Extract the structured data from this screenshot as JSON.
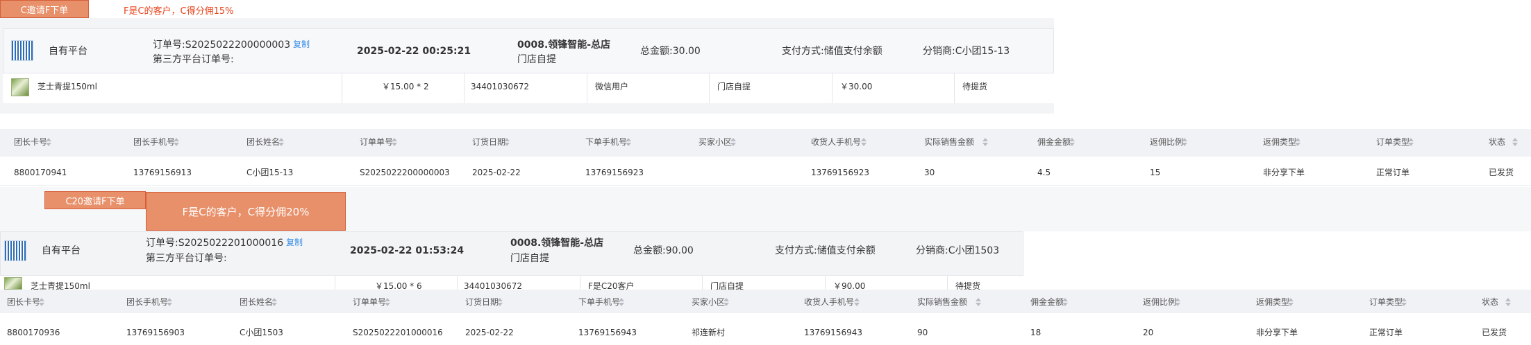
{
  "sections": [
    {
      "tag": "C邀请F下单",
      "note": "F是C的客户，C得分佣15%",
      "order": {
        "platform": "自有平台",
        "order_no": "订单号:S2025022200000003",
        "copy": "复制",
        "third_party": "第三方平台订单号:",
        "datetime": "2025-02-22 00:25:21",
        "store": "0008.领锋智能-总店",
        "pickup": "门店自提",
        "total": "总金额:30.00",
        "payment": "支付方式:储值支付余额",
        "distributor": "分销商:C小团15-13"
      },
      "item": {
        "name": "芝士青提150ml",
        "price_qty": "￥15.00 * 2",
        "phone": "34401030672",
        "buyer": "微信用户",
        "delivery": "门店自提",
        "amount": "￥30.00",
        "status": "待提货"
      },
      "table_row": [
        "8800170941",
        "13769156913",
        "C小团15-13",
        "S2025022200000003",
        "2025-02-22",
        "13769156923",
        "",
        "13769156923",
        "30",
        "4.5",
        "15",
        "非分享下单",
        "正常订单",
        "已发货"
      ]
    },
    {
      "tag": "C20邀请F下单",
      "note": "F是C的客户，C得分佣20%",
      "order": {
        "platform": "自有平台",
        "order_no": "订单号:S2025022201000016",
        "copy": "复制",
        "third_party": "第三方平台订单号:",
        "datetime": "2025-02-22 01:53:24",
        "store": "0008.领锋智能-总店",
        "pickup": "门店自提",
        "total": "总金额:90.00",
        "payment": "支付方式:储值支付余额",
        "distributor": "分销商:C小团1503"
      },
      "item": {
        "name": "芝士青提150ml",
        "price_qty": "￥15.00 * 6",
        "phone": "34401030672",
        "buyer": "F是C20客户",
        "delivery": "门店自提",
        "amount": "￥90.00",
        "status": "待提货"
      },
      "table_row": [
        "8800170936",
        "13769156903",
        "C小团1503",
        "S2025022201000016",
        "2025-02-22",
        "13769156943",
        "祁连新村",
        "13769156943",
        "90",
        "18",
        "20",
        "非分享下单",
        "正常订单",
        "已发货"
      ]
    }
  ],
  "table_headers": [
    "团长卡号",
    "团长手机号",
    "团长姓名",
    "订单单号",
    "订货日期",
    "下单手机号",
    "买家小区",
    "收货人手机号",
    "实际销售金额",
    "佣金金额",
    "返佣比例",
    "返佣类型",
    "订单类型",
    "状态"
  ],
  "colors": {
    "tag_bg": "#e8906a",
    "tag_border": "#d4603b",
    "note_red": "#e8421a",
    "link_blue": "#3b8fe8",
    "header_bg": "#f1f2f5",
    "order_bg": "#f3f4f6"
  }
}
